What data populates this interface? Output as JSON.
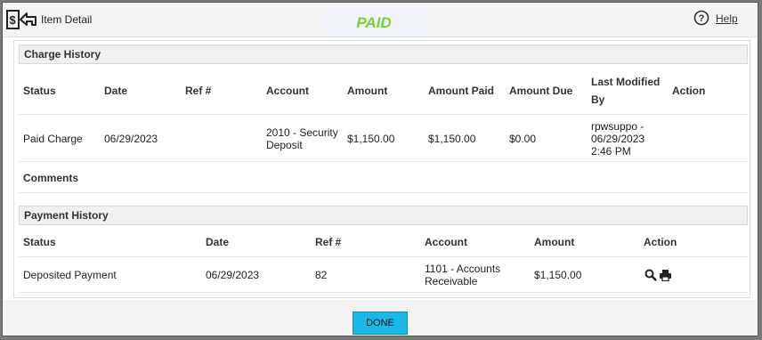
{
  "header": {
    "title": "Item Detail",
    "status": "PAID",
    "help_label": "Help",
    "icons": {
      "item": "money-return-icon",
      "help": "question-circle-icon"
    },
    "status_color": "#7ad135"
  },
  "charge_history": {
    "title": "Charge History",
    "columns": {
      "status": "Status",
      "date": "Date",
      "ref": "Ref #",
      "account": "Account",
      "amount": "Amount",
      "amount_paid": "Amount Paid",
      "amount_due": "Amount Due",
      "last_modified_1": "Last Modified",
      "last_modified_2": "By",
      "action": "Action"
    },
    "row": {
      "status": "Paid Charge",
      "date": "06/29/2023",
      "ref": "",
      "account_1": "2010 - Security",
      "account_2": "Deposit",
      "amount": "$1,150.00",
      "amount_paid": "$1,150.00",
      "amount_due": "$0.00",
      "modified_1": "rpwsuppo -",
      "modified_2": "06/29/2023",
      "modified_3": "2:46 PM"
    },
    "comments_label": "Comments"
  },
  "payment_history": {
    "title": "Payment History",
    "columns": {
      "status": "Status",
      "date": "Date",
      "ref": "Ref #",
      "account": "Account",
      "amount": "Amount",
      "action": "Action"
    },
    "row": {
      "status": "Deposited Payment",
      "date": "06/29/2023",
      "ref": "82",
      "account_1": "1101 - Accounts",
      "account_2": "Receivable",
      "amount": "$1,150.00",
      "action_icons": [
        "search-icon",
        "print-icon"
      ]
    }
  },
  "footer": {
    "done_label": "DONE",
    "button_color": "#1ab8e6"
  }
}
